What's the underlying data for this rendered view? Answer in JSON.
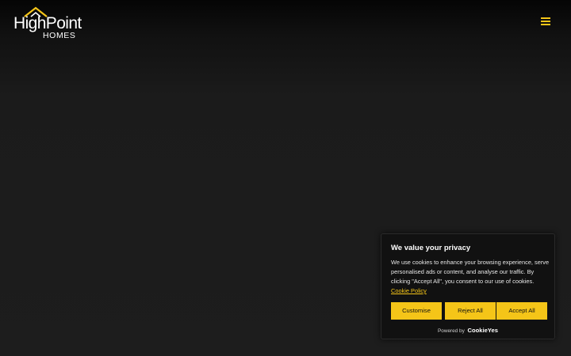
{
  "header": {
    "logo": {
      "line1": "HighPoint",
      "line2": "HOMES",
      "mark_icon": "mountain-roof-icon",
      "mark_color": "#f5c518"
    },
    "menu": {
      "icon": "hamburger-menu-icon",
      "color": "#f5c518"
    }
  },
  "cookie_banner": {
    "title": "We value your privacy",
    "body": "We use cookies to enhance your browsing experience, serve personalised ads or content, and analyse our traffic. By clicking \"Accept All\", you consent to our use of cookies.",
    "policy_link": "Cookie Policy",
    "buttons": {
      "customise": "Customise",
      "reject": "Reject All",
      "accept": "Accept All"
    },
    "powered_by": "Powered by",
    "powered_brand": "CookieYes",
    "accent_color": "#f5c518"
  },
  "colors": {
    "background": "#1d1d1d",
    "banner_background": "#111111",
    "accent": "#f5c518"
  }
}
